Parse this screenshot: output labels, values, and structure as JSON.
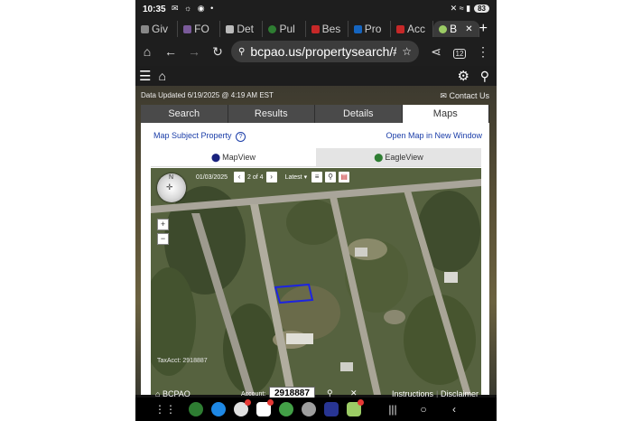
{
  "status": {
    "time": "10:35",
    "left_icons": "✉ ☼ ◉ •",
    "right_icons": "✕ ≈ ▮",
    "battery": "83"
  },
  "browser": {
    "tabs": [
      {
        "label": "Giv",
        "color": "#888888"
      },
      {
        "label": "FO",
        "color": "#7a5a9a"
      },
      {
        "label": "Det",
        "color": "#bbbbbb"
      },
      {
        "label": "Pul",
        "color": "#2e7d32"
      },
      {
        "label": "Bes",
        "color": "#c62828"
      },
      {
        "label": "Pro",
        "color": "#1565c0"
      },
      {
        "label": "Acc",
        "color": "#c62828"
      },
      {
        "label": "B",
        "color": "#9ccc65"
      }
    ],
    "active_tab_close": "✕",
    "new_tab": "+",
    "url": "bcpao.us/propertysearch/#/",
    "tab_count": "12"
  },
  "site": {
    "data_updated": "Data Updated 6/19/2025 @ 4:19 AM EST",
    "contact": "Contact Us",
    "tabs": [
      "Search",
      "Results",
      "Details",
      "Maps"
    ],
    "active_tab": "Maps",
    "map_subject": "Map Subject Property",
    "open_map": "Open Map in New Window",
    "views": [
      "MapView",
      "EagleView"
    ],
    "active_view": "MapView"
  },
  "map": {
    "date": "01/03/2025",
    "page": "2 of 4",
    "latest": "Latest",
    "tax_acct": "TaxAcct: 2918887",
    "compass_n": "N",
    "zoom_in": "+",
    "zoom_out": "−"
  },
  "footer": {
    "brand": "BCPAO",
    "account_label": "Account:",
    "account_value": "2918887",
    "instructions": "Instructions",
    "separator": "|",
    "disclaimer": "Disclaimer"
  },
  "colors": {
    "link": "#1a3da8",
    "parcel": "#1d24e0"
  }
}
